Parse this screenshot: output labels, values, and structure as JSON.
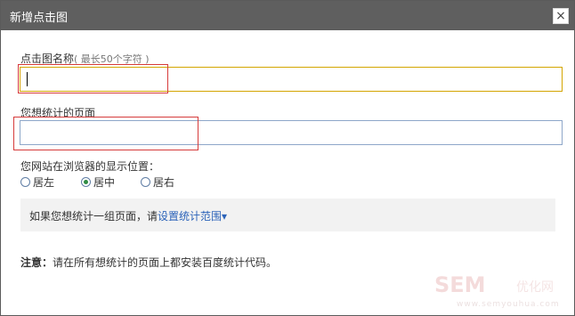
{
  "dialog": {
    "title": "新增点击图",
    "close_icon": "close-icon"
  },
  "form": {
    "name_label": "点击图名称",
    "name_hint": "( 最长50个字符 )",
    "name_value": "",
    "page_label": "您想统计的页面",
    "page_value": "",
    "position_label": "您网站在浏览器的显示位置：",
    "positions": [
      {
        "label": "居左",
        "selected": false
      },
      {
        "label": "居中",
        "selected": true
      },
      {
        "label": "居右",
        "selected": false
      }
    ]
  },
  "info": {
    "text": "如果您想统计一组页面，请",
    "link_text": "设置统计范围",
    "link_icon": "chevron-down-icon"
  },
  "note": {
    "prefix": "注意：",
    "text": "请在所有想统计的页面上都安装百度统计代码。"
  },
  "watermark": {
    "main": "SEM",
    "side": "优化网",
    "sub": "www.semyouhua.com"
  }
}
